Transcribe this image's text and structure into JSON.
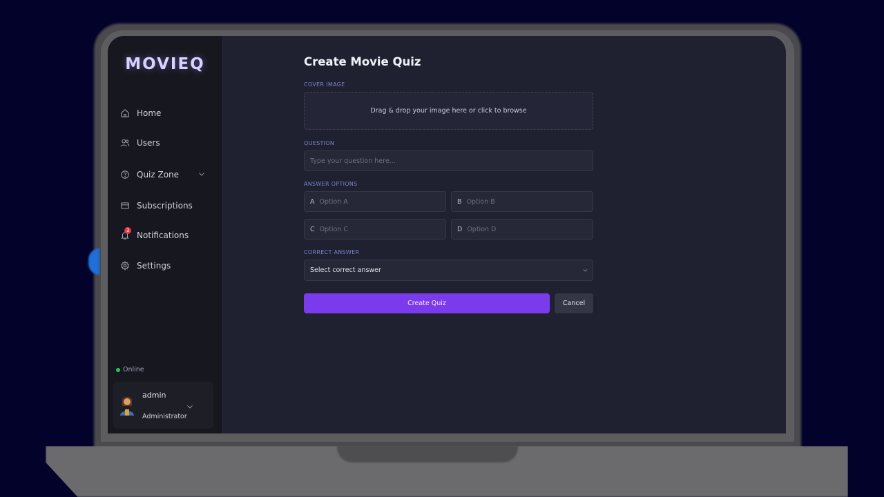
{
  "app": {
    "brand": "MOVIEQ"
  },
  "sidebar": {
    "items": [
      {
        "label": "Home",
        "icon": "home-icon"
      },
      {
        "label": "Users",
        "icon": "users-icon"
      },
      {
        "label": "Quiz Zone",
        "icon": "help-circle-icon",
        "expandable": true
      },
      {
        "label": "Subscriptions",
        "icon": "credit-card-icon"
      },
      {
        "label": "Notifications",
        "icon": "bell-icon",
        "badge": "3"
      },
      {
        "label": "Settings",
        "icon": "gear-icon"
      }
    ],
    "status": "Online",
    "user": {
      "name": "admin",
      "role": "Administrator"
    }
  },
  "form": {
    "title": "Create Movie Quiz",
    "cover_label": "COVER IMAGE",
    "dropzone_text": "Drag & drop your image here or click to browse",
    "question_label": "QUESTION",
    "question_placeholder": "Type your question here...",
    "answers_label": "ANSWER OPTIONS",
    "options": [
      {
        "letter": "A",
        "placeholder": "Option A"
      },
      {
        "letter": "B",
        "placeholder": "Option B"
      },
      {
        "letter": "C",
        "placeholder": "Option C"
      },
      {
        "letter": "D",
        "placeholder": "Option D"
      }
    ],
    "correct_label": "CORRECT ANSWER",
    "correct_select": "Select correct answer",
    "submit_label": "Create Quiz",
    "cancel_label": "Cancel"
  },
  "colors": {
    "accent": "#7c3aed",
    "background": "#1f2030",
    "sidebar": "#17181f",
    "online": "#22c55e",
    "badge": "#e53945"
  }
}
